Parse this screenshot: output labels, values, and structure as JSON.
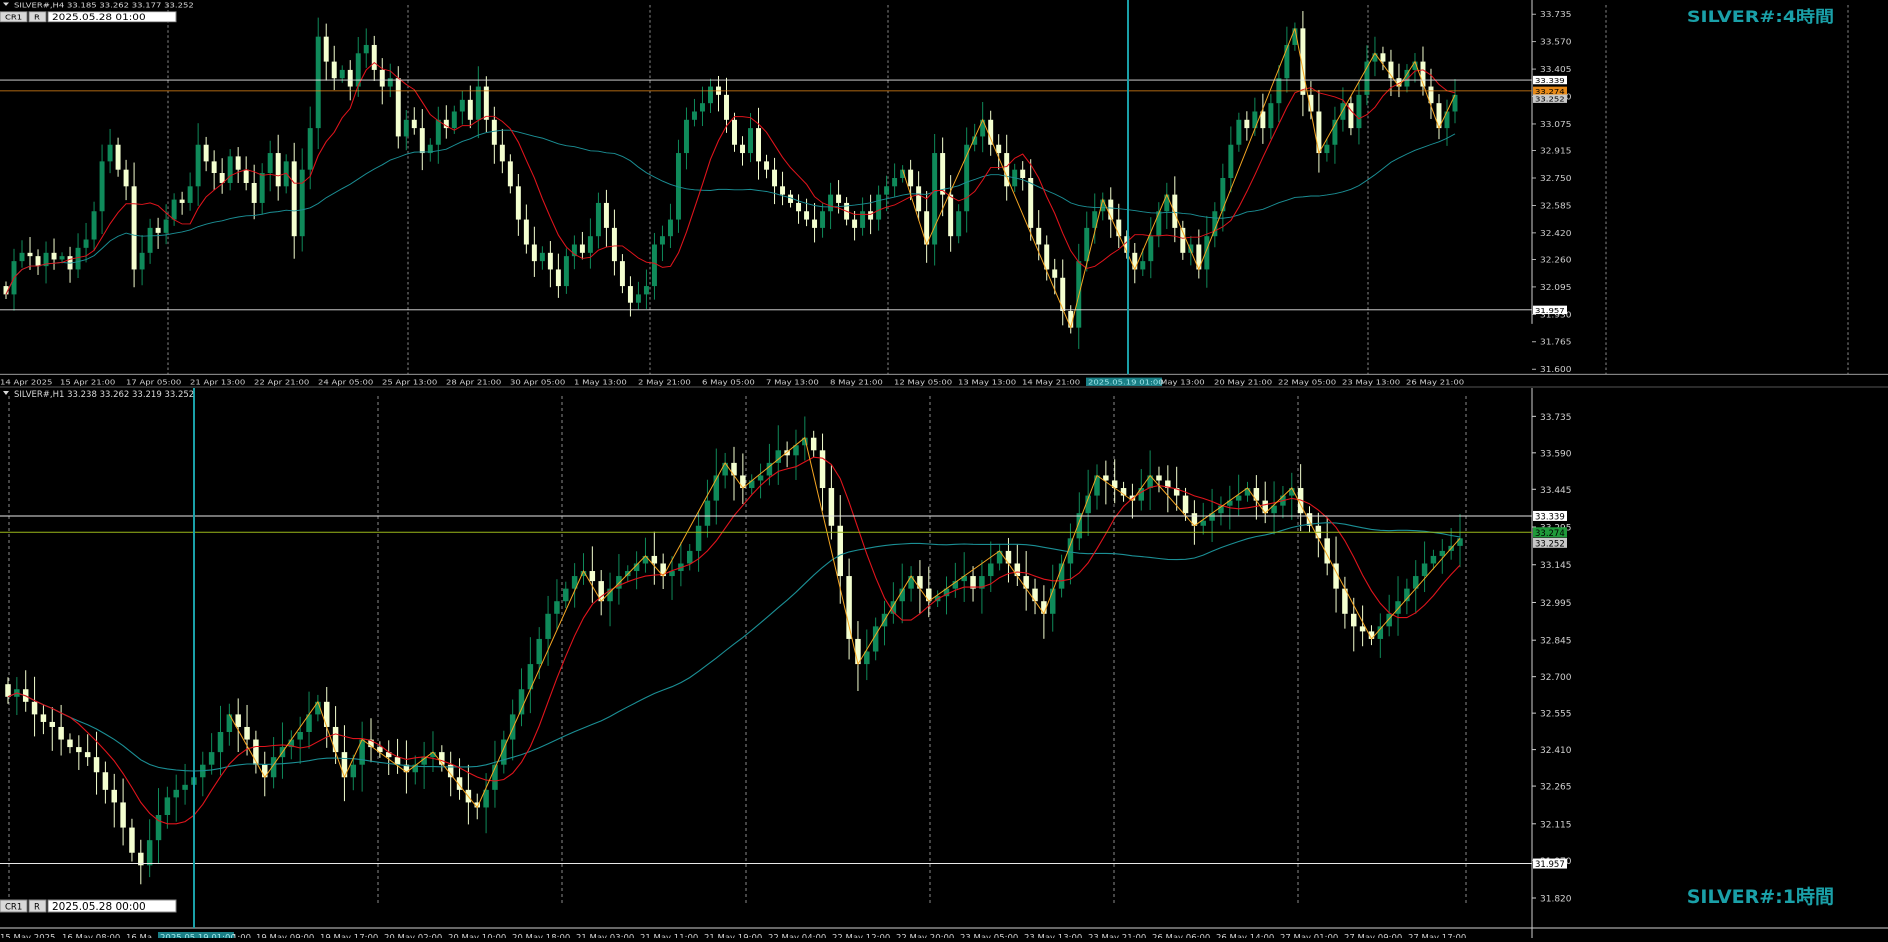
{
  "colors": {
    "background": "#000000",
    "bull": "#0f8a5a",
    "bear": "#f4ffd0",
    "ma_fast": "#e0141c",
    "ma_slow": "#1b8f95",
    "zigzag": "#f5a623",
    "hline": "#e8e8e8",
    "orange_line": "#e88a18",
    "cursor": "#1aa0a8",
    "grid": "#8a8a8a",
    "panel_title": "#1aa0a8"
  },
  "panels": [
    {
      "id": "h4",
      "header": "SILVER#,H4  33.185 33.262 33.177 33.252",
      "title": "SILVER#:4時間",
      "btn_cr": "CR1",
      "btn_r": "R",
      "datetime_box": "2025.05.28 01:00",
      "cursor_label": "2025.05.19 01:00",
      "y_ticks": [
        "33.735",
        "33.570",
        "33.405",
        "33.240",
        "33.075",
        "32.915",
        "32.750",
        "32.585",
        "32.420",
        "32.260",
        "32.095",
        "31.930",
        "31.765",
        "31.600"
      ],
      "y_range": [
        31.6,
        33.77
      ],
      "hlines": [
        {
          "value": 33.339,
          "label": "33.339",
          "color": "#e8e8e8",
          "label_bg": "#ffffff",
          "label_fg": "#000000"
        },
        {
          "value": 33.274,
          "label": "33.274",
          "color": "#e88a18",
          "label_bg": "#e88a18",
          "label_fg": "#000000"
        },
        {
          "value": 33.252,
          "label": "33.252",
          "color": "#000000",
          "label_bg": "#c8c8c8",
          "label_fg": "#000000"
        },
        {
          "value": 31.957,
          "label": "31.957",
          "color": "#e8e8e8",
          "label_bg": "#ffffff",
          "label_fg": "#000000"
        }
      ],
      "x_labels": [
        "14 Apr 2025",
        "15 Apr 21:00",
        "17 Apr 05:00",
        "21 Apr 13:00",
        "22 Apr 21:00",
        "24 Apr 05:00",
        "25 Apr 13:00",
        "28 Apr 21:00",
        "30 Apr 05:00",
        "1 May 13:00",
        "2 May 21:00",
        "6 May 05:00",
        "7 May 13:00",
        "8 May 21:00",
        "12 May 05:00",
        "13 May 13:00",
        "14 May 21:00",
        "2025.05.19 01:00",
        "May 13:00",
        "20 May 21:00",
        "22 May 05:00",
        "23 May 13:00",
        "26 May 21:00"
      ]
    },
    {
      "id": "h1",
      "header": "SILVER#,H1  33.238 33.262 33.219 33.252",
      "title": "SILVER#:1時間",
      "btn_cr": "CR1",
      "btn_r": "R",
      "datetime_box": "2025.05.28 00:00",
      "cursor_label": "2025.05.19 01:00",
      "y_ticks": [
        "33.735",
        "33.590",
        "33.445",
        "33.295",
        "33.145",
        "32.995",
        "32.845",
        "32.700",
        "32.555",
        "32.410",
        "32.265",
        "32.115",
        "31.970",
        "31.820"
      ],
      "y_range": [
        31.82,
        33.8
      ],
      "hlines": [
        {
          "value": 33.339,
          "label": "33.339",
          "color": "#e8e8e8",
          "label_bg": "#ffffff",
          "label_fg": "#000000"
        },
        {
          "value": 33.274,
          "label": "33.274",
          "color": "#9ab81a",
          "label_bg": "#1f9a3a",
          "label_fg": "#000000"
        },
        {
          "value": 33.252,
          "label": "33.252",
          "color": "#000000",
          "label_bg": "#c8c8c8",
          "label_fg": "#000000"
        },
        {
          "value": 31.957,
          "label": "31.957",
          "color": "#e8e8e8",
          "label_bg": "#ffffff",
          "label_fg": "#000000"
        }
      ],
      "x_labels": [
        "15 May 2025",
        "16 May 08:00",
        "16 Ma",
        "2025.05.19 01:00",
        "1:00",
        "19 May 09:00",
        "19 May 17:00",
        "20 May 02:00",
        "20 May 10:00",
        "20 May 18:00",
        "21 May 03:00",
        "21 May 11:00",
        "21 May 19:00",
        "22 May 04:00",
        "22 May 12:00",
        "22 May 20:00",
        "23 May 05:00",
        "23 May 13:00",
        "23 May 21:00",
        "26 May 06:00",
        "26 May 14:00",
        "27 May 01:00",
        "27 May 09:00",
        "27 May 17:00"
      ]
    }
  ],
  "chart_data": [
    {
      "type": "candlestick",
      "title": "SILVER#:4時間",
      "symbol": "SILVER#,H4",
      "ohlc_header": [
        33.185,
        33.262,
        33.177,
        33.252
      ],
      "ylim": [
        31.6,
        33.77
      ],
      "grid": true,
      "close": [
        32.05,
        32.25,
        32.3,
        32.28,
        32.22,
        32.3,
        32.26,
        32.28,
        32.2,
        32.33,
        32.38,
        32.55,
        32.85,
        32.95,
        32.8,
        32.7,
        32.2,
        32.3,
        32.45,
        32.42,
        32.5,
        32.62,
        32.6,
        32.7,
        32.95,
        32.85,
        32.78,
        32.72,
        32.88,
        32.8,
        32.72,
        32.6,
        32.78,
        32.9,
        32.7,
        32.85,
        32.4,
        32.8,
        33.05,
        33.6,
        33.45,
        33.35,
        33.4,
        33.3,
        33.5,
        33.55,
        33.4,
        33.3,
        33.35,
        33.0,
        33.1,
        33.05,
        32.9,
        32.95,
        33.1,
        33.05,
        33.15,
        33.22,
        33.1,
        33.3,
        33.1,
        32.95,
        32.85,
        32.7,
        32.5,
        32.35,
        32.25,
        32.3,
        32.2,
        32.1,
        32.28,
        32.35,
        32.3,
        32.4,
        32.6,
        32.45,
        32.25,
        32.1,
        32.0,
        32.05,
        32.1,
        32.35,
        32.4,
        32.5,
        32.9,
        33.1,
        33.15,
        33.2,
        33.3,
        33.25,
        33.1,
        32.95,
        32.9,
        33.05,
        32.85,
        32.8,
        32.7,
        32.65,
        32.6,
        32.55,
        32.5,
        32.45,
        32.55,
        32.65,
        32.6,
        32.5,
        32.45,
        32.55,
        32.5,
        32.65,
        32.7,
        32.75,
        32.8,
        32.7,
        32.55,
        32.35,
        32.9,
        32.65,
        32.4,
        32.55,
        32.95,
        33.0,
        33.1,
        32.95,
        32.9,
        32.7,
        32.8,
        32.75,
        32.45,
        32.35,
        32.2,
        32.15,
        31.95,
        31.85,
        32.25,
        32.45,
        32.55,
        32.62,
        32.5,
        32.4,
        32.3,
        32.2,
        32.25,
        32.4,
        32.55,
        32.65,
        32.45,
        32.3,
        32.35,
        32.2,
        32.4,
        32.55,
        32.75,
        32.95,
        33.1,
        33.05,
        33.15,
        33.05,
        33.2,
        33.35,
        33.55,
        33.65,
        33.25,
        33.15,
        32.9,
        32.95,
        33.1,
        33.2,
        33.05,
        33.25,
        33.45,
        33.5,
        33.45,
        33.35,
        33.3,
        33.4,
        33.45,
        33.3,
        33.2,
        33.05,
        33.15,
        33.25
      ],
      "ma_fast_color": "#e0141c",
      "ma_slow_color": "#1b8f95",
      "zigzag_color": "#f5a623",
      "hlines": [
        33.339,
        33.274,
        31.957
      ]
    },
    {
      "type": "candlestick",
      "title": "SILVER#:1時間",
      "symbol": "SILVER#,H1",
      "ohlc_header": [
        33.238,
        33.262,
        33.219,
        33.252
      ],
      "ylim": [
        31.82,
        33.8
      ],
      "grid": true,
      "close": [
        32.62,
        32.65,
        32.6,
        32.55,
        32.52,
        32.5,
        32.45,
        32.42,
        32.4,
        32.38,
        32.32,
        32.25,
        32.2,
        32.1,
        32.0,
        31.95,
        32.05,
        32.15,
        32.22,
        32.25,
        32.27,
        32.3,
        32.35,
        32.4,
        32.48,
        32.55,
        32.5,
        32.45,
        32.35,
        32.3,
        32.38,
        32.42,
        32.45,
        32.48,
        32.55,
        32.6,
        32.5,
        32.4,
        32.3,
        32.35,
        32.45,
        32.42,
        32.4,
        32.38,
        32.35,
        32.32,
        32.35,
        32.38,
        32.4,
        32.35,
        32.3,
        32.25,
        32.2,
        32.18,
        32.25,
        32.35,
        32.45,
        32.55,
        32.65,
        32.75,
        32.85,
        32.95,
        33.0,
        33.05,
        33.1,
        33.12,
        33.08,
        33.0,
        33.05,
        33.1,
        33.12,
        33.15,
        33.18,
        33.15,
        33.1,
        33.12,
        33.15,
        33.2,
        33.3,
        33.4,
        33.5,
        33.55,
        33.5,
        33.45,
        33.48,
        33.5,
        33.55,
        33.6,
        33.58,
        33.62,
        33.65,
        33.6,
        33.45,
        33.3,
        33.1,
        32.85,
        32.75,
        32.8,
        32.9,
        32.95,
        33.0,
        33.05,
        33.1,
        33.05,
        33.0,
        33.02,
        33.05,
        33.08,
        33.1,
        33.05,
        33.1,
        33.15,
        33.2,
        33.15,
        33.1,
        33.05,
        33.0,
        32.95,
        33.05,
        33.15,
        33.25,
        33.35,
        33.42,
        33.5,
        33.48,
        33.45,
        33.42,
        33.4,
        33.45,
        33.5,
        33.48,
        33.45,
        33.42,
        33.35,
        33.3,
        33.32,
        33.35,
        33.38,
        33.4,
        33.42,
        33.45,
        33.4,
        33.35,
        33.38,
        33.42,
        33.45,
        33.35,
        33.3,
        33.25,
        33.15,
        33.05,
        32.95,
        32.9,
        32.88,
        32.85,
        32.9,
        32.95,
        33.0,
        33.05,
        33.1,
        33.15,
        33.18,
        33.2,
        33.22,
        33.25
      ],
      "ma_fast_color": "#e0141c",
      "ma_slow_color": "#1b8f95",
      "zigzag_color": "#f5a623",
      "hlines": [
        33.339,
        33.274,
        31.957
      ]
    }
  ]
}
